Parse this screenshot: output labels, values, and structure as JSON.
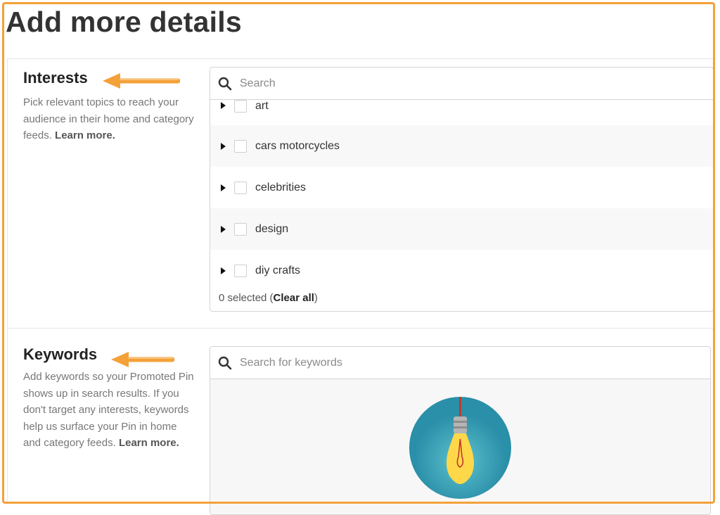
{
  "page": {
    "title": "Add more details"
  },
  "interests": {
    "heading": "Interests",
    "description_text": "Pick relevant topics to reach your audience in their home and category feeds. ",
    "learn_more": "Learn more.",
    "search_placeholder": "Search",
    "items": [
      {
        "label": "art"
      },
      {
        "label": "cars motorcycles"
      },
      {
        "label": "celebrities"
      },
      {
        "label": "design"
      },
      {
        "label": "diy crafts"
      }
    ],
    "selected_text": "0 selected (",
    "clear_all": "Clear all",
    "selected_suffix": ")"
  },
  "keywords": {
    "heading": "Keywords",
    "description_text": "Add keywords so your Promoted Pin shows up in search results. If you don't target any interests, keywords help us surface your Pin in home and category feeds. ",
    "learn_more": "Learn more.",
    "search_placeholder": "Search for keywords"
  },
  "colors": {
    "annotation_frame": "#f4a13a",
    "arrow": "#f4a13a",
    "illustration_bg": "#2a8fa8",
    "bulb": "#ffd84a"
  },
  "icons": {
    "search": "search-icon",
    "expand": "caret-right-icon",
    "annotation": "arrow-left-icon",
    "illustration": "lightbulb-icon"
  }
}
